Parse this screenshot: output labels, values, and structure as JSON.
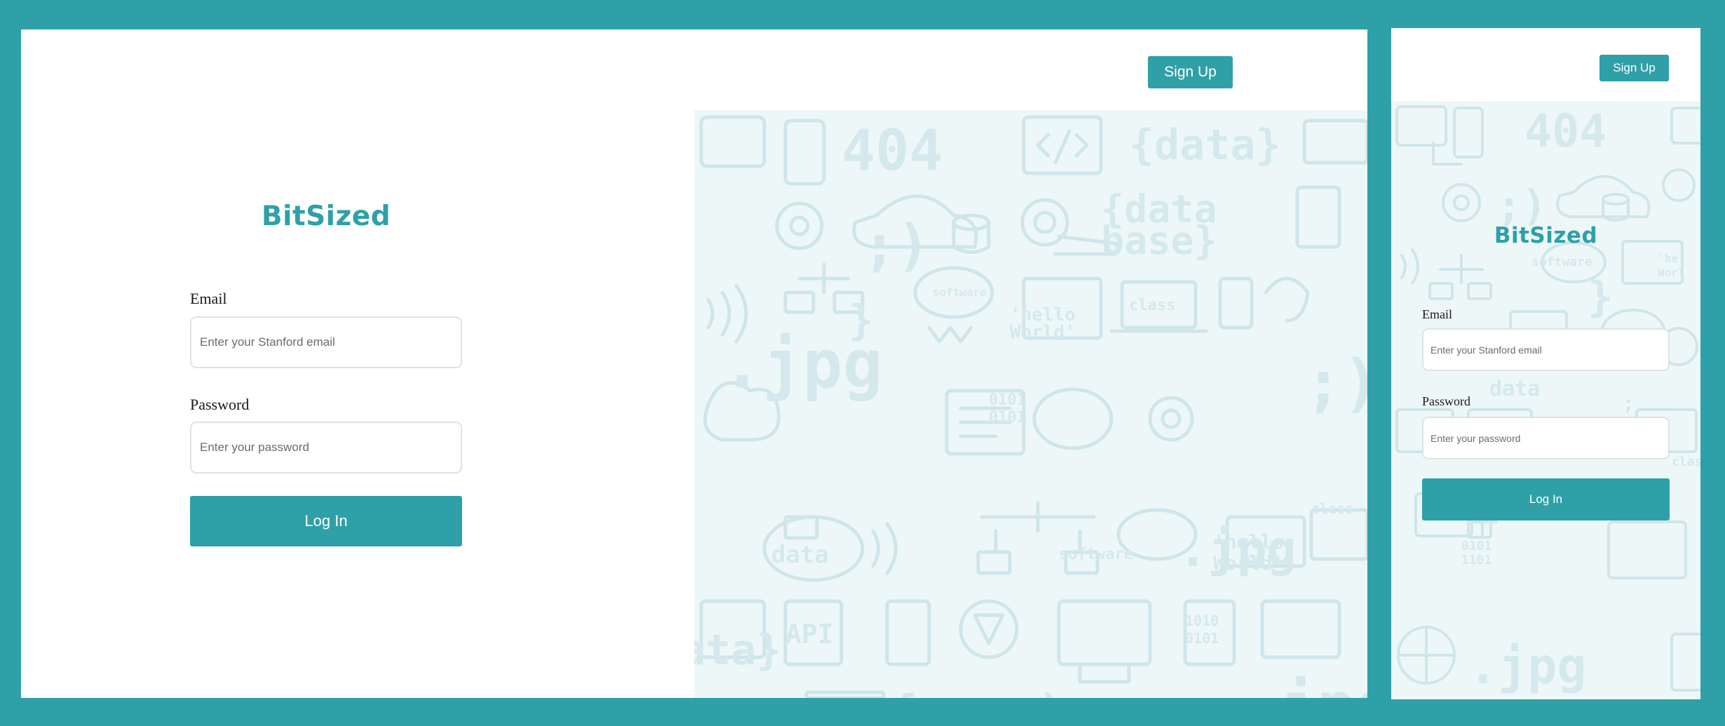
{
  "brand": "BitSized",
  "header": {
    "signup_label": "Sign Up"
  },
  "login_form": {
    "email_label": "Email",
    "email_placeholder": "Enter your Stanford email",
    "password_label": "Password",
    "password_placeholder": "Enter your password",
    "login_label": "Log In"
  },
  "pattern_words": [
    "404",
    "{data}",
    "{data base}",
    ".jpg",
    "'hello World'",
    "class",
    "software",
    "data",
    "API",
    "0101"
  ],
  "colors": {
    "accent": "#2fa0a8",
    "page_background": "#2fa0a8",
    "panel_background": "#ffffff",
    "pattern_tint": "#eef7f8",
    "pattern_ink": "#cfe6e9",
    "field_border": "#dde3e6"
  }
}
